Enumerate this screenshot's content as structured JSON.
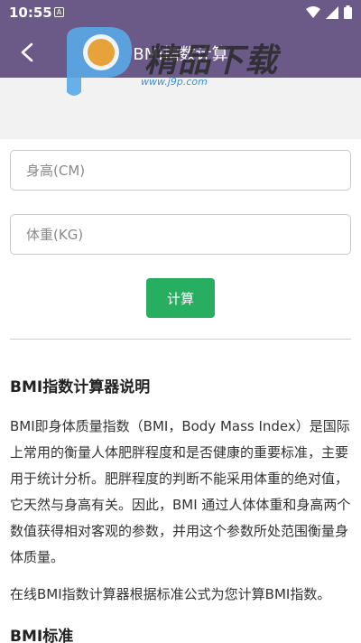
{
  "status_bar": {
    "time": "10:55",
    "notification_glyph": "A",
    "icons": [
      "wifi-icon",
      "signal-icon",
      "battery-icon"
    ]
  },
  "app_bar": {
    "title": "BMI指数计算",
    "back_icon": "chevron-left-icon",
    "color": "#6b5a88"
  },
  "watermark": {
    "text": "精品下载",
    "url": "www.j9p.com"
  },
  "form": {
    "height_placeholder": "身高(CM)",
    "weight_placeholder": "体重(KG)",
    "submit_label": "计算",
    "submit_color": "#27ae60"
  },
  "info": {
    "title": "BMI指数计算器说明",
    "paragraph1": "BMI即身体质量指数（BMI，Body Mass Index）是国际上常用的衡量人体肥胖程度和是否健康的重要标准，主要用于统计分析。肥胖程度的判断不能采用体重的绝对值，它天然与身高有关。因此，BMI 通过人体体重和身高两个数值获得相对客观的参数，并用这个参数所处范围衡量身体质量。",
    "paragraph2": "在线BMI指数计算器根据标准公式为您计算BMI指数。",
    "title2": "BMI标准"
  }
}
